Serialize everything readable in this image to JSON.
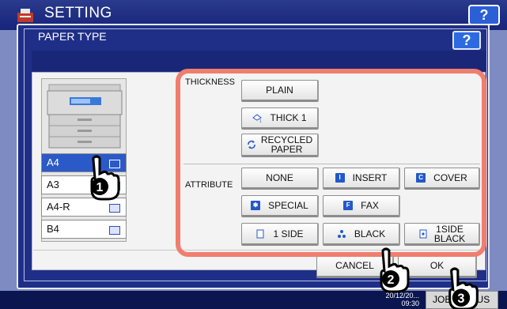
{
  "background": {
    "title": "SETTING",
    "help_label": "?",
    "footer_time": "09:30",
    "footer_date": "20/12/20...",
    "job_label": "JOB STATUS"
  },
  "dialog": {
    "title": "PAPER TYPE",
    "help_label": "?"
  },
  "trays": [
    {
      "label": "A4",
      "selected": true
    },
    {
      "label": "A3",
      "selected": false
    },
    {
      "label": "A4-R",
      "selected": false
    },
    {
      "label": "B4",
      "selected": false
    }
  ],
  "thickness": {
    "label": "THICKNESS",
    "options": [
      {
        "label": "PLAIN",
        "icon": null
      },
      {
        "label": "THICK 1",
        "icon": "thick-paper-icon"
      },
      {
        "label": "RECYCLED PAPER",
        "line1": "RECYCLED",
        "line2": "PAPER",
        "icon": "recycled-icon"
      }
    ]
  },
  "attribute": {
    "label": "ATTRIBUTE",
    "options": [
      {
        "label": "NONE",
        "icon": null
      },
      {
        "label": "INSERT",
        "icon": "insert-icon"
      },
      {
        "label": "COVER",
        "icon": "cover-icon"
      },
      {
        "label": "SPECIAL",
        "icon": "special-icon"
      },
      {
        "label": "FAX",
        "icon": "fax-icon"
      },
      {
        "label": "1 SIDE",
        "icon": "one-side-icon"
      },
      {
        "label": "BLACK",
        "icon": "black-icon"
      },
      {
        "label": "1SIDE BLACK",
        "line1": "1SIDE",
        "line2": "BLACK",
        "icon": "one-side-black-icon"
      }
    ]
  },
  "actions": {
    "cancel_label": "CANCEL",
    "ok_label": "OK"
  },
  "callouts": [
    "1",
    "2",
    "3"
  ],
  "colors": {
    "highlight": "#f07e6e",
    "selected_tray": "#2c59c8",
    "dialog_bg": "#1f2f88"
  }
}
